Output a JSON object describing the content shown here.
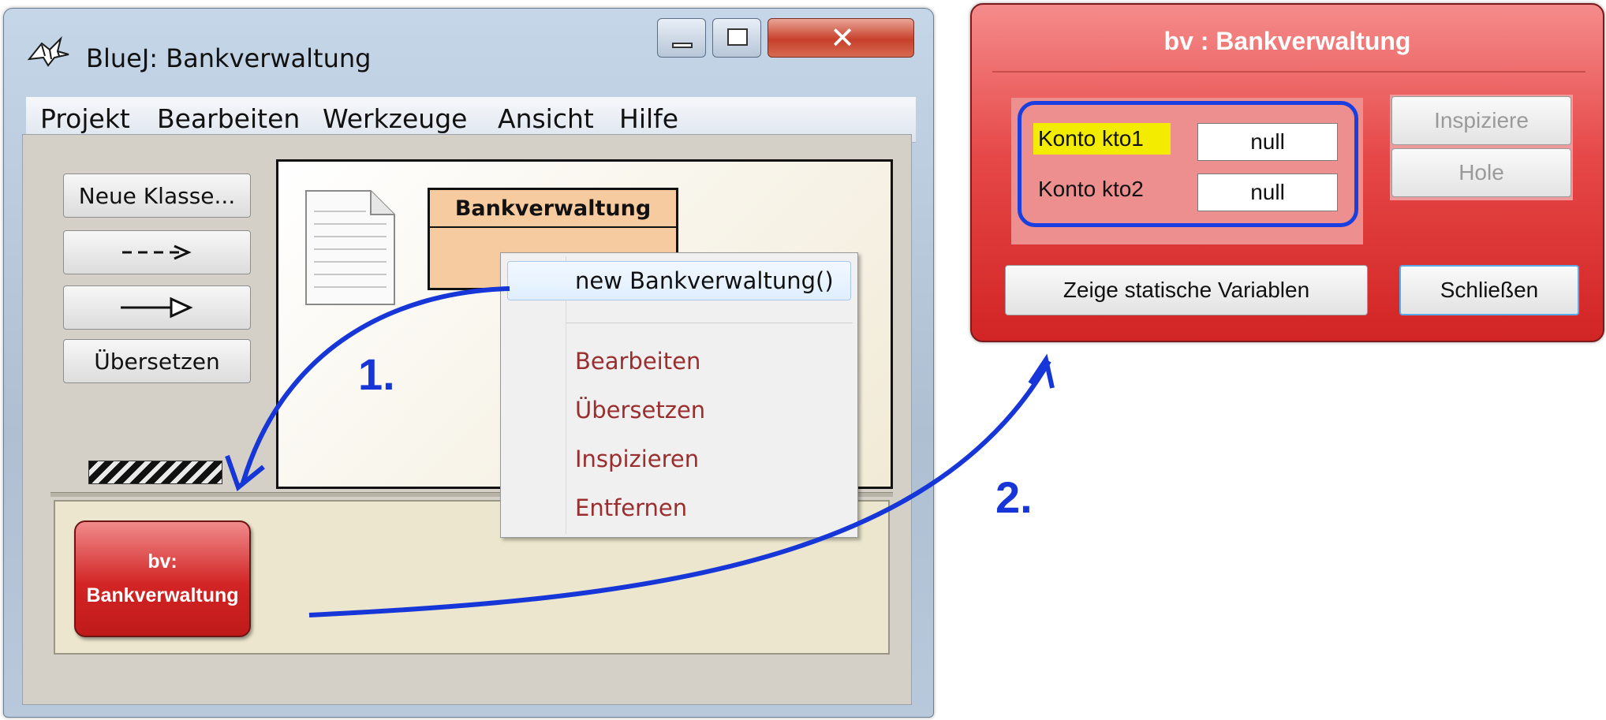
{
  "main_window": {
    "title": "BlueJ:  Bankverwaltung",
    "menu": [
      "Projekt",
      "Bearbeiten",
      "Werkzeuge",
      "Ansicht",
      "Hilfe"
    ],
    "sidebar": {
      "new_class": "Neue Klasse...",
      "dependency_arrow": "--->",
      "inheritance_arrow": "—▷",
      "compile": "Übersetzen"
    },
    "class": {
      "name": "Bankverwaltung"
    },
    "object_bench": {
      "object_name": "bv:",
      "object_class": "Bankverwaltung"
    }
  },
  "context_menu": {
    "items": [
      "new Bankverwaltung()",
      "Bearbeiten",
      "Übersetzen",
      "Inspizieren",
      "Entfernen"
    ],
    "colors": {
      "constructor": "#111111",
      "action": "#9a2e2e"
    }
  },
  "inspector": {
    "title": "bv : Bankverwaltung",
    "fields": [
      {
        "label": "Konto kto1",
        "value": "null"
      },
      {
        "label": "Konto kto2",
        "value": "null"
      }
    ],
    "buttons": {
      "inspect": "Inspiziere",
      "get": "Hole",
      "show_static": "Zeige statische Variablen",
      "close": "Schließen"
    }
  },
  "annotations": {
    "step1": "1.",
    "step2": "2."
  },
  "colors": {
    "annotation": "#1636d8",
    "highlight_field": "#f4ec00",
    "object_red": "#d22424"
  }
}
